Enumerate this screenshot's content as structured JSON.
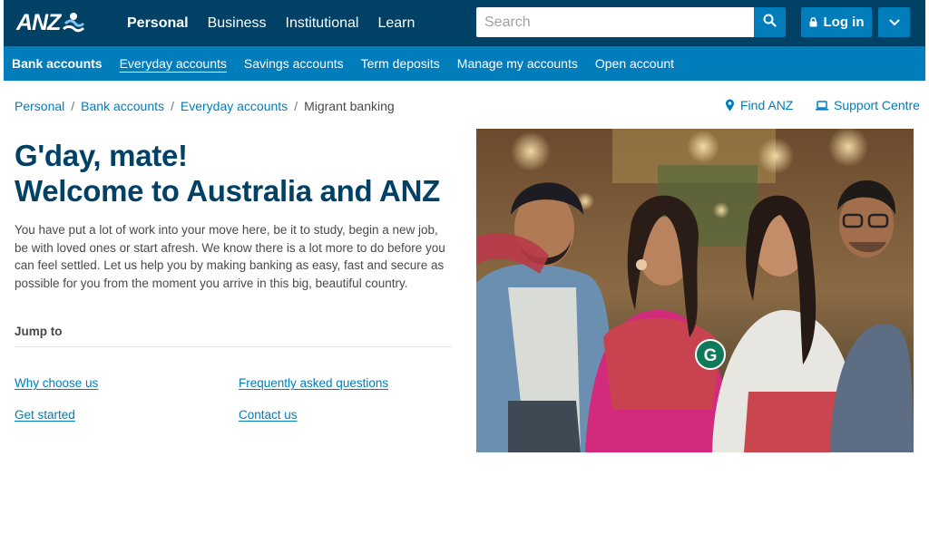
{
  "brand": {
    "logo_text": "ANZ",
    "primary": "#004165",
    "accent": "#007dba"
  },
  "main_nav": [
    "Personal",
    "Business",
    "Institutional",
    "Learn"
  ],
  "search": {
    "placeholder": "Search",
    "value": ""
  },
  "login_label": "Log in",
  "sub_nav": {
    "section": "Bank accounts",
    "items": [
      "Everyday accounts",
      "Savings accounts",
      "Term deposits",
      "Manage my accounts",
      "Open account"
    ]
  },
  "breadcrumb": [
    "Personal",
    "Bank accounts",
    "Everyday accounts",
    "Migrant banking"
  ],
  "utility": {
    "find_anz": "Find ANZ",
    "support_centre": "Support Centre"
  },
  "heading": {
    "line1": "G'day, mate!",
    "line2": "Welcome to Australia and ANZ"
  },
  "intro": "You have put a lot of work into your move here, be it to study, begin a new job, be with loved ones or start afresh. We know there is a lot more to do before you can feel settled. Let us help you by making banking as easy, fast and secure as possible for you from the moment you arrive in this big, beautiful country.",
  "jump_to": {
    "label": "Jump to",
    "links": [
      "Why choose us",
      "Frequently asked questions",
      "Get started",
      "Contact us"
    ]
  },
  "hero": {
    "badge_letter": "G"
  }
}
